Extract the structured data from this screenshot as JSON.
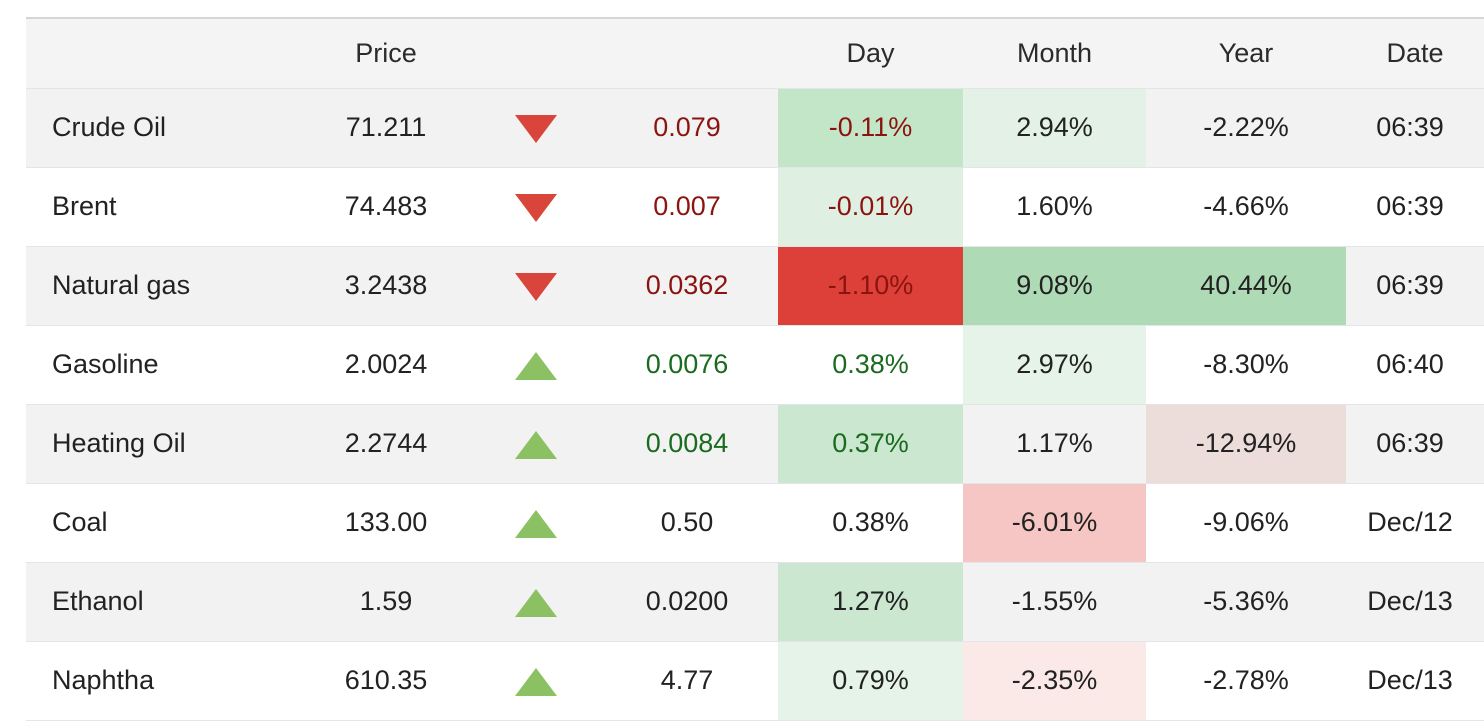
{
  "table": {
    "name": "commodities-price-table",
    "columns": [
      {
        "key": "name",
        "label": ""
      },
      {
        "key": "price",
        "label": "Price"
      },
      {
        "key": "arrow",
        "label": ""
      },
      {
        "key": "change",
        "label": ""
      },
      {
        "key": "day",
        "label": "Day"
      },
      {
        "key": "month",
        "label": "Month"
      },
      {
        "key": "year",
        "label": "Year"
      },
      {
        "key": "date",
        "label": "Date"
      }
    ],
    "rows": [
      {
        "name": "Crude Oil",
        "price": "71.211",
        "direction": "down",
        "direction_icon": "triangle-down-icon",
        "change": "0.079",
        "change_tone": "down",
        "day": "-0.11%",
        "day_tone": "down",
        "day_bg": "#c3e6c9",
        "month": "2.94%",
        "month_tone": "neutral",
        "month_bg": "#e4f1e6",
        "year": "-2.22%",
        "year_tone": "neutral",
        "year_bg": "transparent",
        "date": "06:39"
      },
      {
        "name": "Brent",
        "price": "74.483",
        "direction": "down",
        "direction_icon": "triangle-down-icon",
        "change": "0.007",
        "change_tone": "down",
        "day": "-0.01%",
        "day_tone": "down",
        "day_bg": "#dff0e2",
        "month": "1.60%",
        "month_tone": "neutral",
        "month_bg": "transparent",
        "year": "-4.66%",
        "year_tone": "neutral",
        "year_bg": "transparent",
        "date": "06:39"
      },
      {
        "name": "Natural gas",
        "price": "3.2438",
        "direction": "down",
        "direction_icon": "triangle-down-icon",
        "change": "0.0362",
        "change_tone": "down",
        "day": "-1.10%",
        "day_tone": "down",
        "day_bg": "#dc4038",
        "month": "9.08%",
        "month_tone": "neutral",
        "month_bg": "#aedbb6",
        "year": "40.44%",
        "year_tone": "neutral",
        "year_bg": "#aedbb6",
        "date": "06:39"
      },
      {
        "name": "Gasoline",
        "price": "2.0024",
        "direction": "up",
        "direction_icon": "triangle-up-icon",
        "change": "0.0076",
        "change_tone": "up",
        "day": "0.38%",
        "day_tone": "up",
        "day_bg": "transparent",
        "month": "2.97%",
        "month_tone": "neutral",
        "month_bg": "#e6f3e8",
        "year": "-8.30%",
        "year_tone": "neutral",
        "year_bg": "transparent",
        "date": "06:40"
      },
      {
        "name": "Heating Oil",
        "price": "2.2744",
        "direction": "up",
        "direction_icon": "triangle-up-icon",
        "change": "0.0084",
        "change_tone": "up",
        "day": "0.37%",
        "day_tone": "up",
        "day_bg": "#cbe7d0",
        "month": "1.17%",
        "month_tone": "neutral",
        "month_bg": "transparent",
        "year": "-12.94%",
        "year_tone": "neutral",
        "year_bg": "#ecdcda",
        "date": "06:39"
      },
      {
        "name": "Coal",
        "price": "133.00",
        "direction": "up",
        "direction_icon": "triangle-up-icon",
        "change": "0.50",
        "change_tone": "neutral",
        "day": "0.38%",
        "day_tone": "neutral",
        "day_bg": "transparent",
        "month": "-6.01%",
        "month_tone": "neutral",
        "month_bg": "#f5c6c3",
        "year": "-9.06%",
        "year_tone": "neutral",
        "year_bg": "transparent",
        "date": "Dec/12"
      },
      {
        "name": "Ethanol",
        "price": "1.59",
        "direction": "up",
        "direction_icon": "triangle-up-icon",
        "change": "0.0200",
        "change_tone": "neutral",
        "day": "1.27%",
        "day_tone": "neutral",
        "day_bg": "#cbe7d0",
        "month": "-1.55%",
        "month_tone": "neutral",
        "month_bg": "transparent",
        "year": "-5.36%",
        "year_tone": "neutral",
        "year_bg": "transparent",
        "date": "Dec/13"
      },
      {
        "name": "Naphtha",
        "price": "610.35",
        "direction": "up",
        "direction_icon": "triangle-up-icon",
        "change": "4.77",
        "change_tone": "neutral",
        "day": "0.79%",
        "day_tone": "neutral",
        "day_bg": "#e6f3e8",
        "month": "-2.35%",
        "month_tone": "neutral",
        "month_bg": "#fbe9e8",
        "year": "-2.78%",
        "year_tone": "neutral",
        "year_bg": "transparent",
        "date": "Dec/13"
      }
    ]
  },
  "colors": {
    "up_arrow": "#8cc163",
    "down_arrow": "#d9453b",
    "up_text": "#1a6b1f",
    "down_text": "#8c1410",
    "header_bg": "#f4f4f4",
    "row_odd_bg": "#f2f2f2",
    "row_even_bg": "#ffffff",
    "grid_line": "#e3e6e8"
  }
}
